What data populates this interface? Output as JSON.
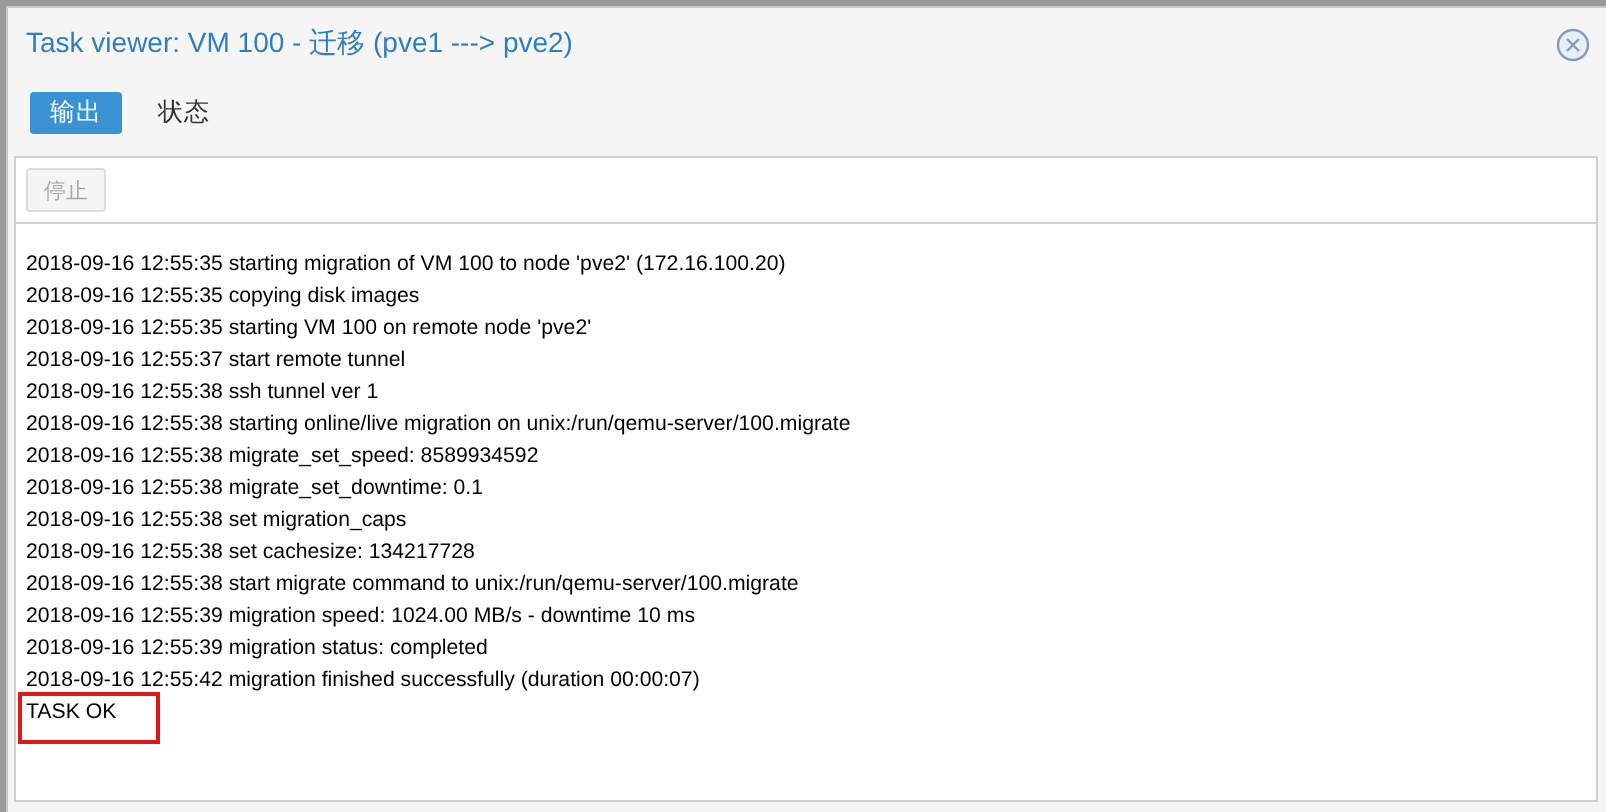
{
  "window": {
    "title": "Task viewer: VM 100 - 迁移 (pve1 ---> pve2)"
  },
  "tabs": [
    {
      "label": "输出",
      "selected": true
    },
    {
      "label": "状态",
      "selected": false
    }
  ],
  "toolbar": {
    "stop_button": {
      "label": "停止",
      "disabled": true
    }
  },
  "log": [
    {
      "text": "2018-09-16 12:55:35 starting migration of VM 100 to node 'pve2' (172.16.100.20)",
      "highlighted": false
    },
    {
      "text": "2018-09-16 12:55:35 copying disk images",
      "highlighted": false
    },
    {
      "text": "2018-09-16 12:55:35 starting VM 100 on remote node 'pve2'",
      "highlighted": false
    },
    {
      "text": "2018-09-16 12:55:37 start remote tunnel",
      "highlighted": false
    },
    {
      "text": "2018-09-16 12:55:38 ssh tunnel ver 1",
      "highlighted": false
    },
    {
      "text": "2018-09-16 12:55:38 starting online/live migration on unix:/run/qemu-server/100.migrate",
      "highlighted": false
    },
    {
      "text": "2018-09-16 12:55:38 migrate_set_speed: 8589934592",
      "highlighted": false
    },
    {
      "text": "2018-09-16 12:55:38 migrate_set_downtime: 0.1",
      "highlighted": false
    },
    {
      "text": "2018-09-16 12:55:38 set migration_caps",
      "highlighted": false
    },
    {
      "text": "2018-09-16 12:55:38 set cachesize: 134217728",
      "highlighted": false
    },
    {
      "text": "2018-09-16 12:55:38 start migrate command to unix:/run/qemu-server/100.migrate",
      "highlighted": false
    },
    {
      "text": "2018-09-16 12:55:39 migration speed: 1024.00 MB/s - downtime 10 ms",
      "highlighted": false
    },
    {
      "text": "2018-09-16 12:55:39 migration status: completed",
      "highlighted": false
    },
    {
      "text": "2018-09-16 12:55:42 migration finished successfully (duration 00:00:07)",
      "highlighted": false
    },
    {
      "text": "TASK OK",
      "highlighted": true
    }
  ]
}
